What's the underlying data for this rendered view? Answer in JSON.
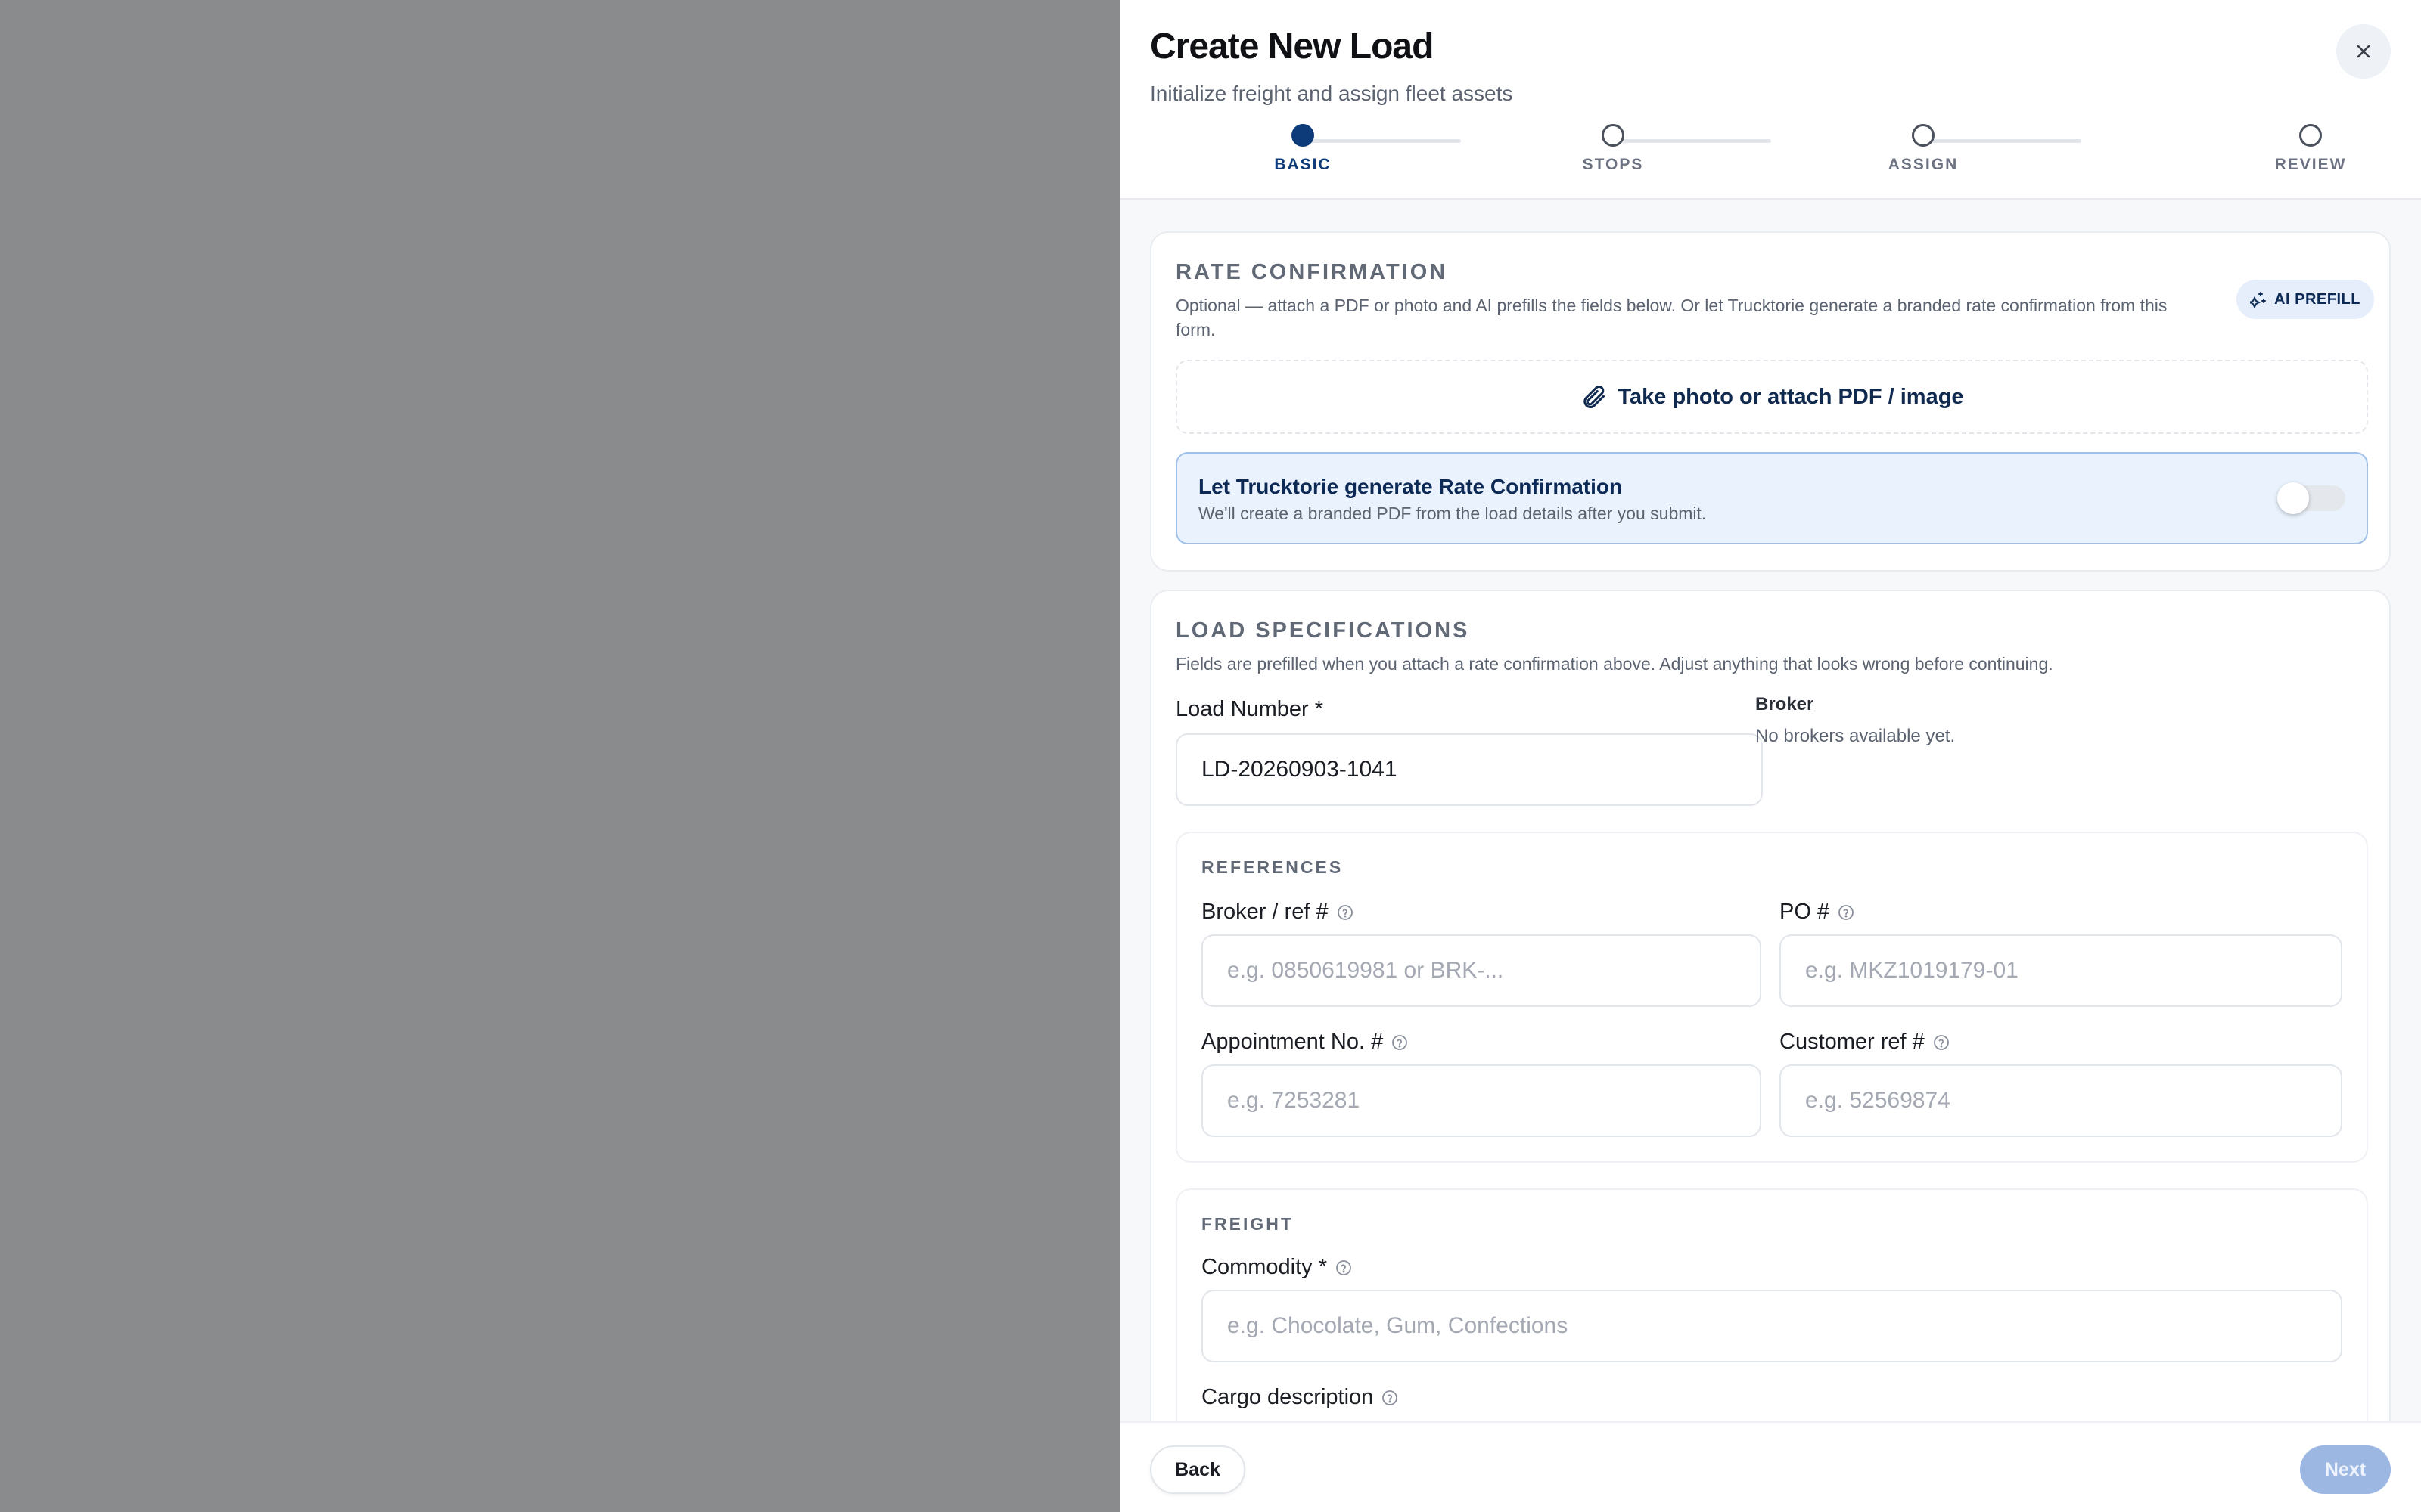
{
  "header": {
    "title": "Create New Load",
    "subtitle": "Initialize freight and assign fleet assets"
  },
  "stepper": {
    "steps": [
      {
        "label": "BASIC",
        "active": true
      },
      {
        "label": "STOPS",
        "active": false
      },
      {
        "label": "ASSIGN",
        "active": false
      },
      {
        "label": "REVIEW",
        "active": false
      }
    ]
  },
  "rate_confirmation": {
    "title": "RATE CONFIRMATION",
    "description": "Optional — attach a PDF or photo and AI prefills the fields below. Or let Trucktorie generate a branded rate confirmation from this form.",
    "ai_prefill_label": "AI PREFILL",
    "attach_label": "Take photo or attach PDF / image",
    "generate": {
      "title": "Let Trucktorie generate Rate Confirmation",
      "description": "We'll create a branded PDF from the load details after you submit.",
      "enabled": false
    }
  },
  "load_specs": {
    "title": "LOAD SPECIFICATIONS",
    "description": "Fields are prefilled when you attach a rate confirmation above. Adjust anything that looks wrong before continuing.",
    "load_number_label": "Load Number *",
    "load_number_value": "LD-20260903-1041",
    "broker_label": "Broker",
    "broker_empty": "No brokers available yet.",
    "references": {
      "title": "REFERENCES",
      "broker_ref_label": "Broker / ref #",
      "broker_ref_placeholder": "e.g. 0850619981 or BRK-...",
      "po_label": "PO #",
      "po_placeholder": "e.g. MKZ1019179-01",
      "appointment_label": "Appointment No. #",
      "appointment_placeholder": "e.g. 7253281",
      "customer_ref_label": "Customer ref #",
      "customer_ref_placeholder": "e.g. 52569874"
    },
    "freight": {
      "title": "FREIGHT",
      "commodity_label": "Commodity *",
      "commodity_placeholder": "e.g. Chocolate, Gum, Confections",
      "cargo_label": "Cargo description"
    }
  },
  "footer": {
    "back_label": "Back",
    "next_label": "Next"
  },
  "colors": {
    "primary": "#0d3b7a",
    "overlay": "#8a8b8d",
    "next_disabled": "#9cb7e2"
  }
}
